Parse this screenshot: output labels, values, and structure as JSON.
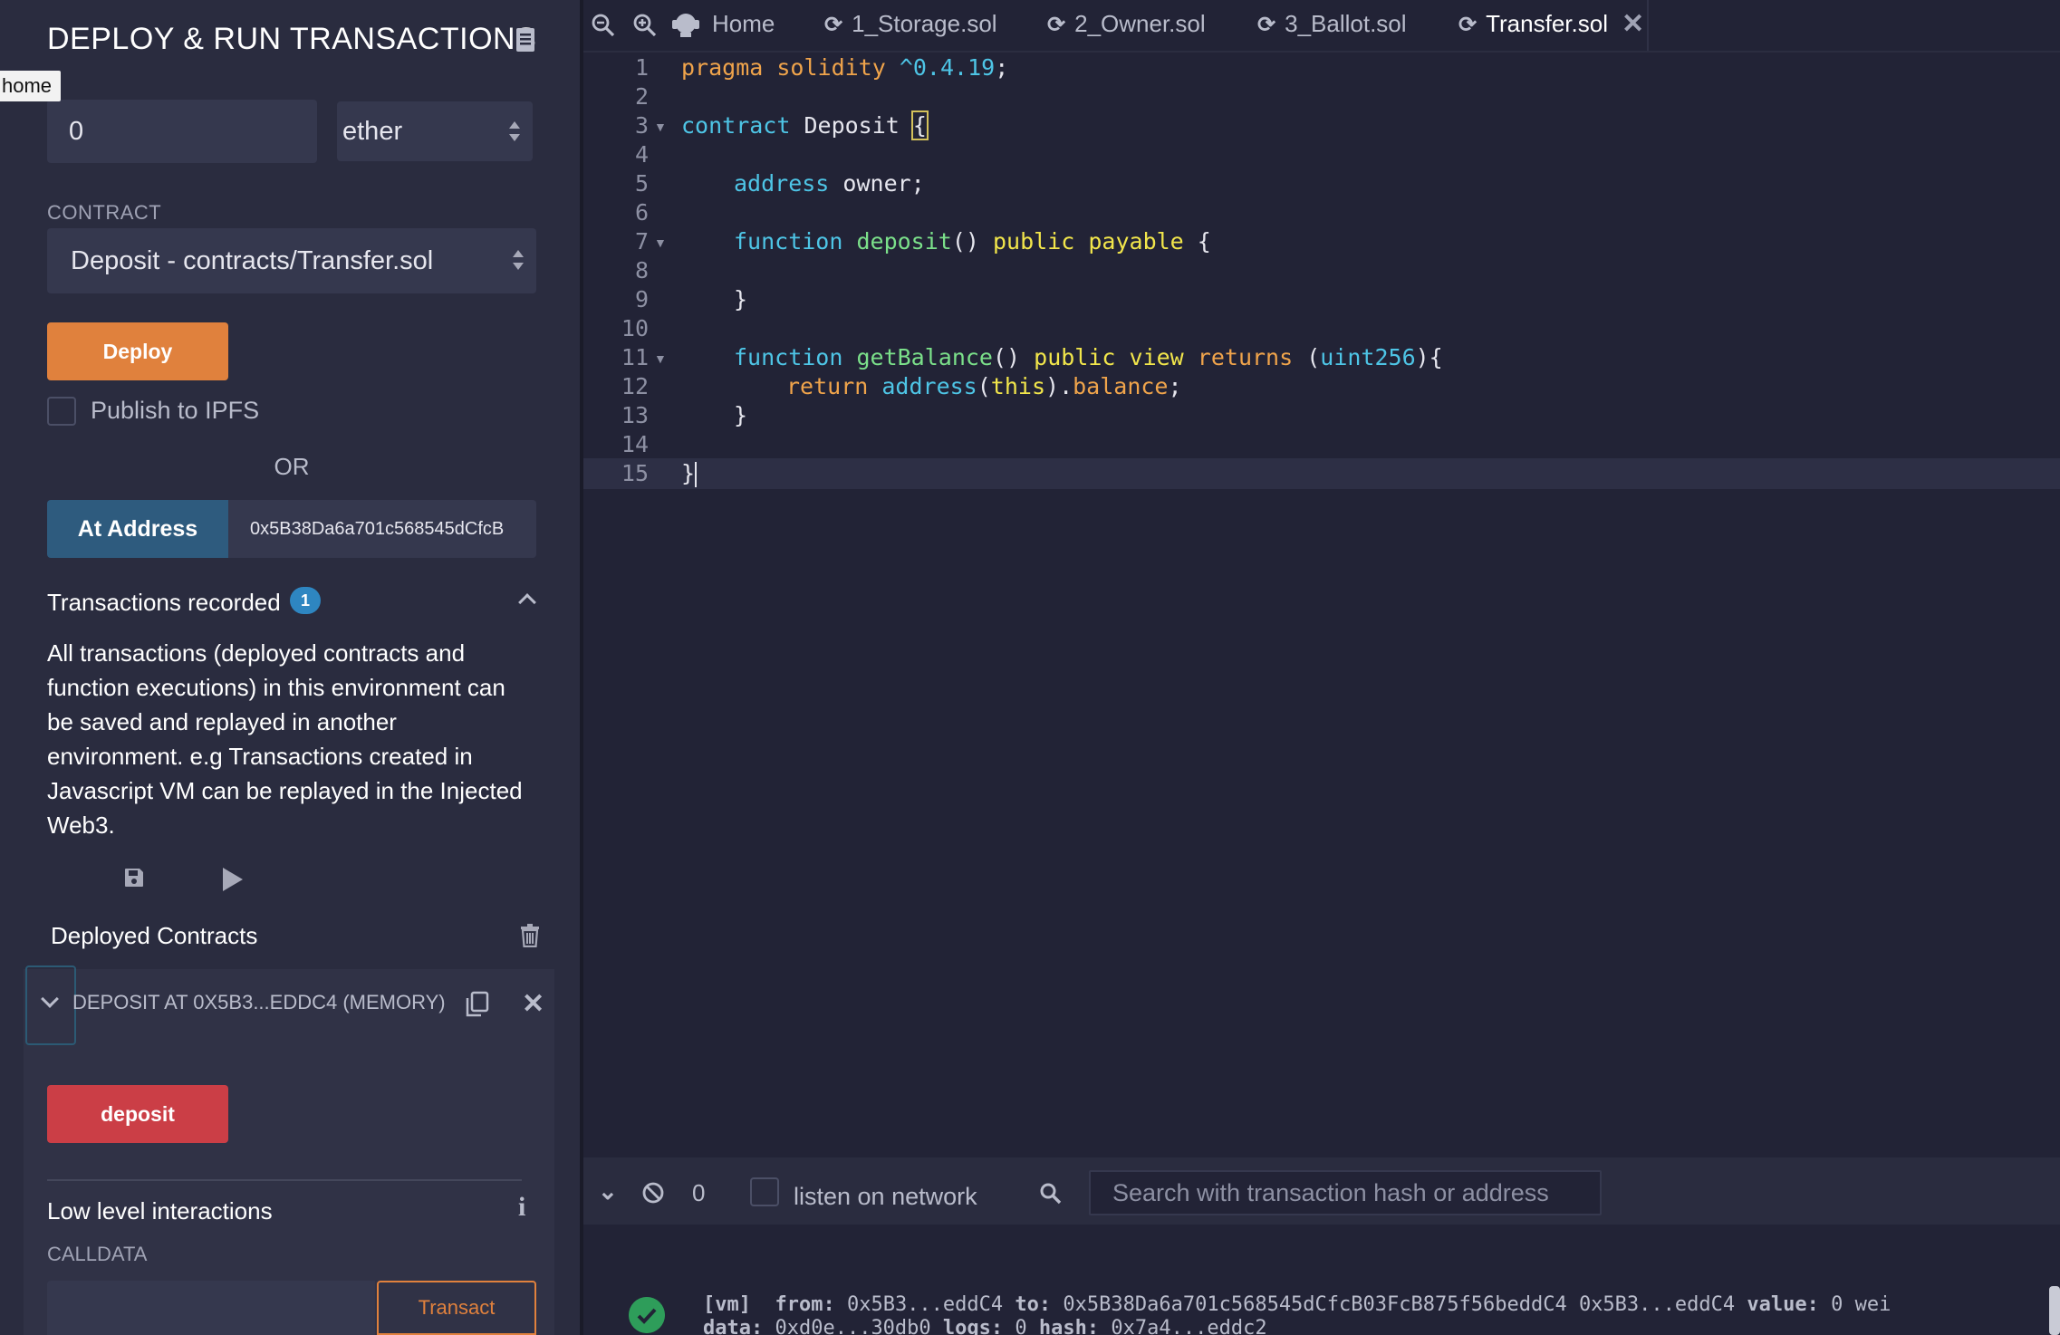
{
  "panel": {
    "title": "DEPLOY & RUN TRANSACTIONS",
    "tooltip": "home",
    "value": "0",
    "unit": "ether",
    "contract_label": "CONTRACT",
    "contract_selected": "Deposit - contracts/Transfer.sol",
    "deploy_label": "Deploy",
    "publish_label": "Publish to IPFS",
    "or_label": "OR",
    "at_address_label": "At Address",
    "at_address_value": "0x5B38Da6a701c568545dCfcB",
    "tx_recorded_label": "Transactions recorded",
    "tx_recorded_count": "1",
    "tx_description": "All transactions (deployed contracts and function executions) in this environment can be saved and replayed in another environment. e.g Transactions created in Javascript VM can be replayed in the Injected Web3.",
    "deployed_contracts_label": "Deployed Contracts",
    "instance_label": "DEPOSIT AT 0X5B3...EDDC4 (MEMORY)",
    "function_button": "deposit",
    "low_level_label": "Low level interactions",
    "info_glyph": "i",
    "calldata_label": "CALLDATA",
    "transact_label": "Transact"
  },
  "tabs": [
    {
      "label": "Home",
      "icon": "home-icon"
    },
    {
      "label": "1_Storage.sol",
      "icon": "sync-icon"
    },
    {
      "label": "2_Owner.sol",
      "icon": "sync-icon"
    },
    {
      "label": "3_Ballot.sol",
      "icon": "sync-icon"
    },
    {
      "label": "Transfer.sol",
      "icon": "sync-icon",
      "active": true
    }
  ],
  "editor": {
    "line_numbers": [
      "1",
      "2",
      "3",
      "4",
      "5",
      "6",
      "7",
      "8",
      "9",
      "10",
      "11",
      "12",
      "13",
      "14",
      "15"
    ],
    "code": {
      "l1_pragma": "pragma solidity",
      "l1_version": " ^0.4.19",
      "l1_end": ";",
      "l3_kw": "contract",
      "l3_name": " Deposit ",
      "l3_brace": "{",
      "l5_type": "address",
      "l5_rest": " owner;",
      "l7_kw": "function",
      "l7_name": " deposit",
      "l7_paren": "() ",
      "l7_public": "public",
      "l7_payable": " payable",
      "l7_brace": " {",
      "l9": "}",
      "l11_kw": "function",
      "l11_name": " getBalance",
      "l11_paren": "() ",
      "l11_public": "public",
      "l11_view": " view",
      "l11_returns": " returns",
      "l11_open": " (",
      "l11_type": "uint256",
      "l11_close": "){",
      "l12_return": "return",
      "l12_address": " address",
      "l12_open": "(",
      "l12_this": "this",
      "l12_close": ").",
      "l12_balance": "balance",
      "l12_end": ";",
      "l13": "}",
      "l15": "}"
    }
  },
  "terminal": {
    "count": "0",
    "listen_label": "listen on network",
    "search_placeholder": "Search with transaction hash or address",
    "log_line1_vm": "[vm]",
    "log_line1_from_key": "from:",
    "log_line1_from": " 0x5B3...eddC4 ",
    "log_line1_to_key": "to:",
    "log_line1_to": " 0x5B38Da6a701c568545dCfcB03FcB875f56beddC4 0x5B3...eddC4 ",
    "log_line1_value_key": "value:",
    "log_line1_value": " 0 wei",
    "log_line2_data_key": "data:",
    "log_line2_data": " 0xd0e...30db0 ",
    "log_line2_logs_key": "logs:",
    "log_line2_logs": " 0 ",
    "log_line2_hash_key": "hash:",
    "log_line2_hash": " 0x7a4...eddc2"
  },
  "colors": {
    "deploy": "#e0813d",
    "at_address": "#2e5b7e",
    "function_button": "#cb3e46",
    "badge": "#2e86c1",
    "success": "#2e9d5a"
  }
}
